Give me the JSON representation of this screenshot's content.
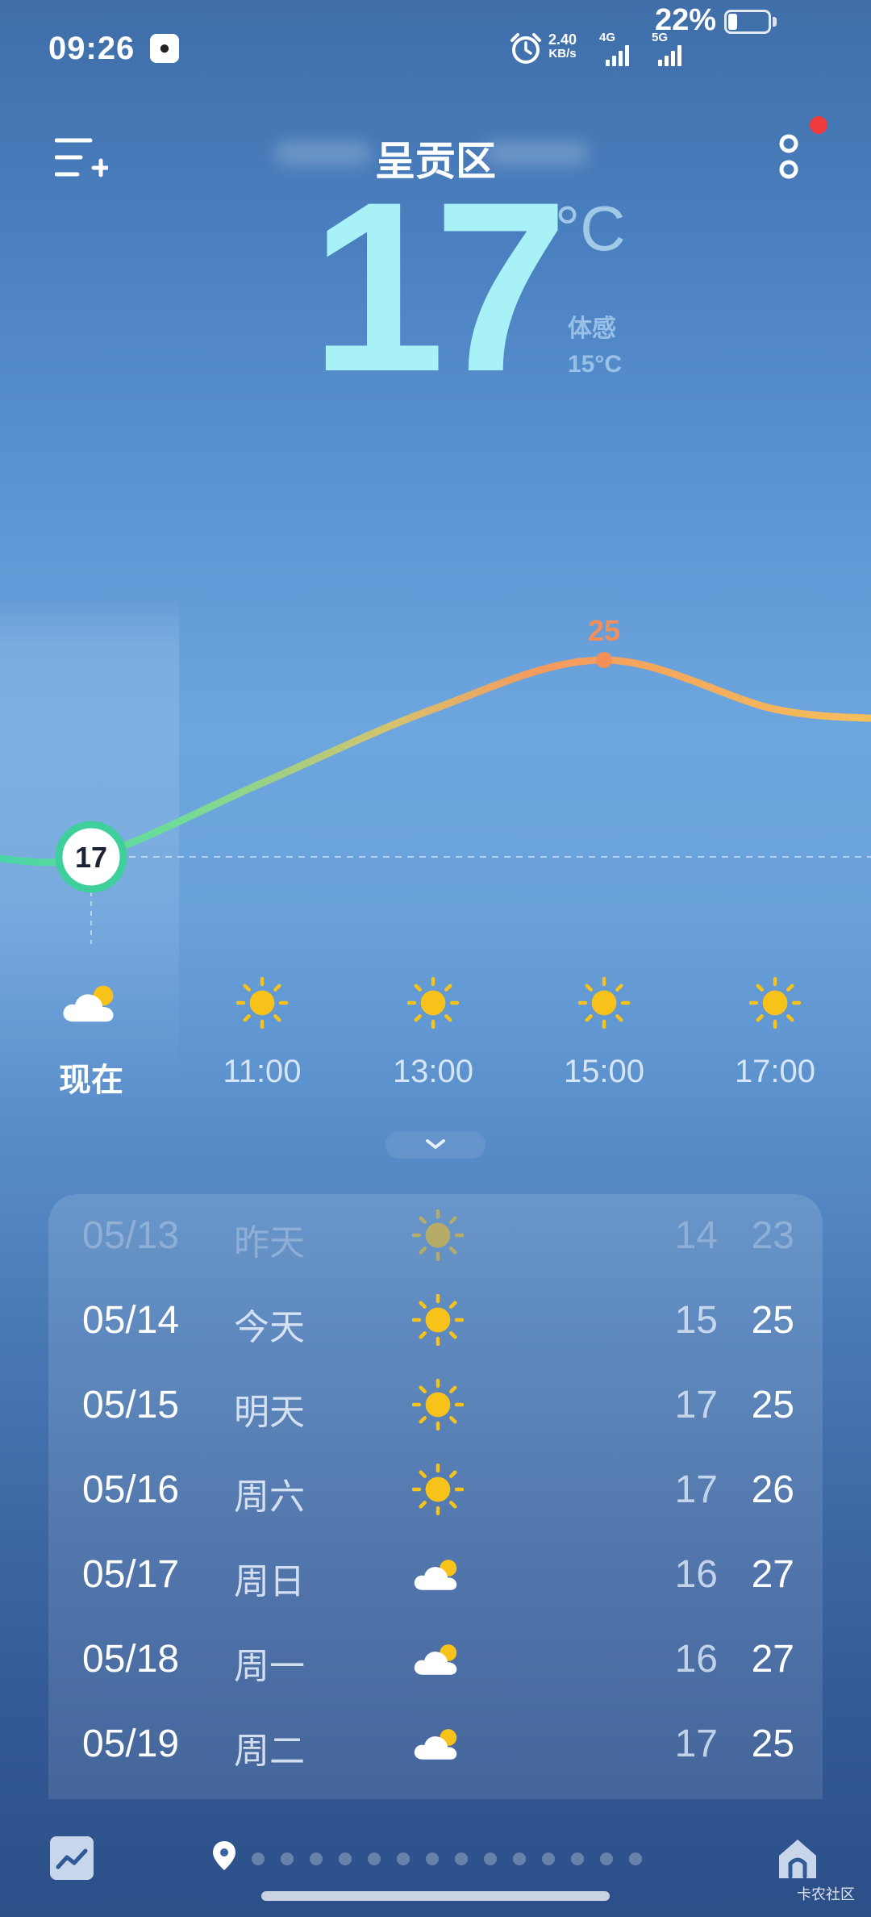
{
  "status_bar": {
    "time": "09:26",
    "net_speed_value": "2.40",
    "net_speed_unit": "KB/s",
    "sim1_label": "4G",
    "sim2_label": "5G",
    "battery": "22%"
  },
  "header": {
    "city": "呈贡区"
  },
  "current": {
    "temp": "17",
    "unit": "°C",
    "feels_label": "体感",
    "feels_value": "15°C"
  },
  "chart_data": {
    "type": "line",
    "categories": [
      "现在",
      "11:00",
      "13:00",
      "15:00",
      "17:00"
    ],
    "values": [
      17,
      20,
      23,
      25,
      23
    ],
    "point_labels": {
      "现在": "17",
      "15:00": "25"
    },
    "grid": false
  },
  "hourly": [
    {
      "time": "现在",
      "icon": "cloudy-sun-icon"
    },
    {
      "time": "11:00",
      "icon": "sun-icon"
    },
    {
      "time": "13:00",
      "icon": "sun-icon"
    },
    {
      "time": "15:00",
      "icon": "sun-icon"
    },
    {
      "time": "17:00",
      "icon": "sun-icon"
    }
  ],
  "daily": [
    {
      "date": "05/13",
      "day": "昨天",
      "icon": "sun-icon",
      "low": "14",
      "high": "23",
      "past": true
    },
    {
      "date": "05/14",
      "day": "今天",
      "icon": "sun-icon",
      "low": "15",
      "high": "25"
    },
    {
      "date": "05/15",
      "day": "明天",
      "icon": "sun-icon",
      "low": "17",
      "high": "25"
    },
    {
      "date": "05/16",
      "day": "周六",
      "icon": "sun-icon",
      "low": "17",
      "high": "26"
    },
    {
      "date": "05/17",
      "day": "周日",
      "icon": "cloudy-sun-icon",
      "low": "16",
      "high": "27"
    },
    {
      "date": "05/18",
      "day": "周一",
      "icon": "cloudy-sun-icon",
      "low": "16",
      "high": "27"
    },
    {
      "date": "05/19",
      "day": "周二",
      "icon": "cloudy-sun-icon",
      "low": "17",
      "high": "25"
    }
  ],
  "footer": {
    "page_count": 14,
    "watermark": "卡农社区"
  },
  "colors": {
    "sun": "#f7c21a",
    "temp_big": "#a8f1f6",
    "peak": "#f3905a",
    "now_ring": "#3ecf9a",
    "badge": "#ef3b3b"
  }
}
